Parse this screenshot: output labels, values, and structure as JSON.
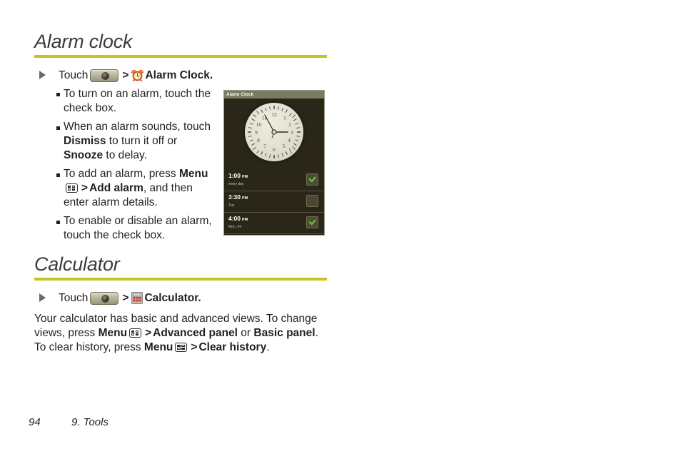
{
  "document": {
    "sections": [
      {
        "heading": "Alarm clock",
        "step": {
          "lead": "Touch",
          "launcher_icon": "app-launcher-icon",
          "separator": ">",
          "app_icon": "alarm-clock-icon",
          "app_label": "Alarm Clock."
        },
        "bullets": [
          {
            "id": "turn-on-alarm",
            "parts": [
              {
                "t": "To turn on an alarm, touch the check box.",
                "b": false
              }
            ]
          },
          {
            "id": "alarm-sounds",
            "parts": [
              {
                "t": "When an alarm sounds, touch ",
                "b": false
              },
              {
                "t": "Dismiss",
                "b": true
              },
              {
                "t": " to turn it off or ",
                "b": false
              },
              {
                "t": "Snooze",
                "b": true
              },
              {
                "t": " to delay.",
                "b": false
              }
            ]
          },
          {
            "id": "add-alarm",
            "parts": [
              {
                "t": "To add an alarm, press ",
                "b": false
              },
              {
                "t": "Menu",
                "b": true
              },
              {
                "t": "MENU_ICON",
                "b": false
              },
              {
                "t": ">",
                "b": true
              },
              {
                "t": "Add alarm",
                "b": true
              },
              {
                "t": ", and then enter alarm details.",
                "b": false
              }
            ]
          },
          {
            "id": "enable-disable-alarm",
            "parts": [
              {
                "t": "To enable or disable an alarm, touch the check box.",
                "b": false
              }
            ]
          }
        ]
      },
      {
        "heading": "Calculator",
        "step": {
          "lead": "Touch",
          "launcher_icon": "app-launcher-icon",
          "separator": ">",
          "app_icon": "calculator-icon",
          "app_label": "Calculator."
        },
        "paragraph": [
          {
            "t": "Your calculator has basic and advanced views. To change views, press ",
            "b": false
          },
          {
            "t": "Menu",
            "b": true
          },
          {
            "t": "MENU_ICON",
            "b": false
          },
          {
            "t": "> ",
            "b": true
          },
          {
            "t": "Advanced panel",
            "b": true
          },
          {
            "t": " or ",
            "b": false
          },
          {
            "t": "Basic panel",
            "b": true
          },
          {
            "t": ". To clear history, press ",
            "b": false
          },
          {
            "t": "Menu",
            "b": true
          },
          {
            "t": "MENU_ICON",
            "b": false
          },
          {
            "t": "> ",
            "b": true
          },
          {
            "t": "Clear history",
            "b": true
          },
          {
            "t": ".",
            "b": false
          }
        ]
      }
    ]
  },
  "bullet_text": {
    "b1_line1": "To turn on an alarm, touch",
    "b1_line2": "the check box.",
    "b2_line1_a": "When an alarm sounds,",
    "b2_line2_a": "touch ",
    "b2_line2_b": "Dismiss",
    "b2_line2_c": " to turn it off",
    "b2_line3_a": "or ",
    "b2_line3_b": "Snooze",
    "b2_line3_c": " to delay.",
    "b3_line1": "To add an alarm, press",
    "b3_menu": "Menu",
    "b3_gt": ">",
    "b3_addalarm": "Add alarm",
    "b3_tail": ", and",
    "b3_line3": "then enter alarm details.",
    "b4_line1": "To enable or disable an",
    "b4_line2": "alarm, touch the check box."
  },
  "calc_para": {
    "l1": "Your calculator has basic and advanced views. To",
    "l2_a": "change views, press ",
    "l2_menu": "Menu",
    "l2_gt": ">",
    "l2_adv": "Advanced panel",
    "l2_or": " or",
    "l3_basic": "Basic panel",
    "l3_mid": ". To clear history, press ",
    "l3_menu": "Menu",
    "l3_gt": ">",
    "l3_clear": "Clear",
    "l4_hist": "history",
    "l4_dot": "."
  },
  "device": {
    "title": "Alarm Clock",
    "clock_numbers": [
      "12",
      "1",
      "2",
      "3",
      "4",
      "5",
      "6",
      "7",
      "8",
      "9",
      "10",
      "11"
    ],
    "clock_time": "3:55",
    "alarms": [
      {
        "time": "1:00",
        "ampm": "PM",
        "days": "every day",
        "enabled": true
      },
      {
        "time": "3:30",
        "ampm": "PM",
        "days": "Tue",
        "enabled": false
      },
      {
        "time": "4:00",
        "ampm": "PM",
        "days": "Mon, Fri",
        "enabled": true
      }
    ]
  },
  "footer": {
    "page_number": "94",
    "chapter": "9. Tools"
  },
  "colors": {
    "rule": "#c6c322",
    "heading": "#3b3b3b",
    "body": "#231f20",
    "device_bg": "#2a2718",
    "device_titlebar": "#7b7b62",
    "check_green": "#5fd12e"
  }
}
